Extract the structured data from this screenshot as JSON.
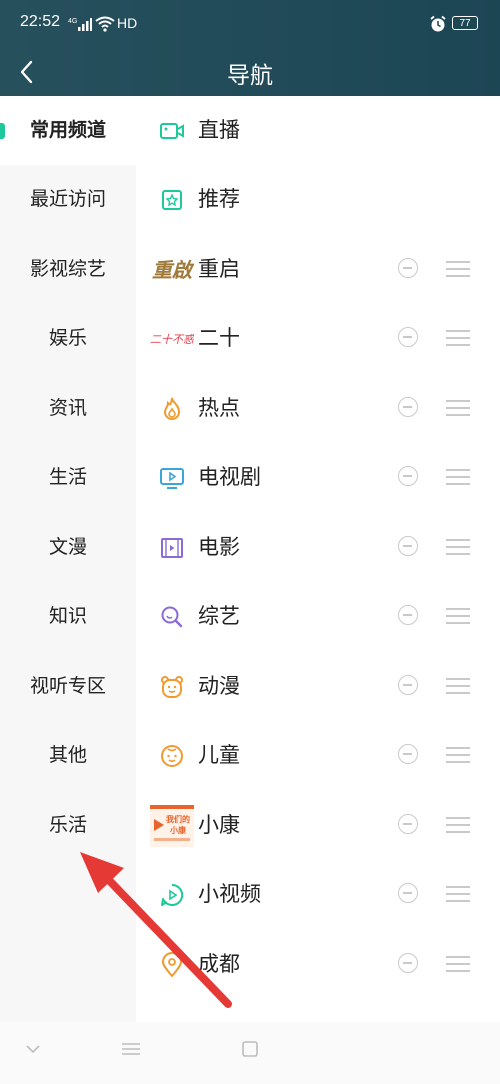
{
  "status_bar": {
    "time": "22:52",
    "network": "4G",
    "hd": "HD",
    "battery": "77"
  },
  "header": {
    "title": "导航"
  },
  "sidebar": {
    "items": [
      {
        "label": "常用频道",
        "active": true
      },
      {
        "label": "最近访问"
      },
      {
        "label": "影视综艺"
      },
      {
        "label": "娱乐"
      },
      {
        "label": "资讯"
      },
      {
        "label": "生活"
      },
      {
        "label": "文漫"
      },
      {
        "label": "知识"
      },
      {
        "label": "视听专区"
      },
      {
        "label": "其他"
      },
      {
        "label": "乐活"
      }
    ]
  },
  "channels": [
    {
      "label": "直播",
      "icon": "live-camera-icon",
      "removable": false
    },
    {
      "label": "推荐",
      "icon": "recommend-star-icon",
      "removable": false
    },
    {
      "label": "重启",
      "icon": "chongqi-logo",
      "logo_text": "重啟",
      "removable": true
    },
    {
      "label": "二十",
      "icon": "ershi-logo",
      "logo_text": "二十不惑",
      "removable": true
    },
    {
      "label": "热点",
      "icon": "flame-icon",
      "removable": true
    },
    {
      "label": "电视剧",
      "icon": "tv-play-icon",
      "removable": true
    },
    {
      "label": "电影",
      "icon": "film-icon",
      "removable": true
    },
    {
      "label": "综艺",
      "icon": "search-variety-icon",
      "removable": true
    },
    {
      "label": "动漫",
      "icon": "bear-face-icon",
      "removable": true
    },
    {
      "label": "儿童",
      "icon": "child-face-icon",
      "removable": true
    },
    {
      "label": "小康",
      "icon": "xiaokang-logo",
      "logo_text": "我们的小康",
      "removable": true
    },
    {
      "label": "小视频",
      "icon": "short-video-play-icon",
      "removable": true
    },
    {
      "label": "成都",
      "icon": "map-pin-icon",
      "removable": true
    }
  ],
  "colors": {
    "header": "#27505d",
    "accent": "#1dc99b",
    "annotation_arrow": "#e53935"
  }
}
